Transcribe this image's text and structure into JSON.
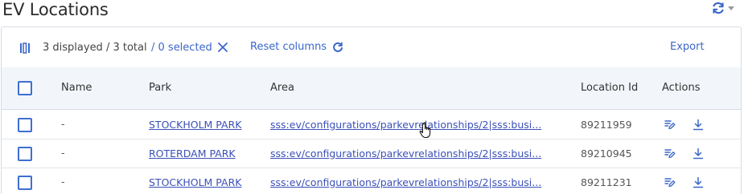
{
  "header": {
    "title": "EV Locations"
  },
  "toolbar": {
    "count_text": "3 displayed / 3 total",
    "selected_text": "/ 0 selected",
    "reset_label": "Reset columns",
    "export_label": "Export"
  },
  "table": {
    "columns": [
      "Name",
      "Park",
      "Area",
      "Location Id",
      "Actions"
    ],
    "rows": [
      {
        "name": "-",
        "park": "STOCKHOLM PARK",
        "area": "sss:ev/configurations/parkevrelationships/2|sss:busi...",
        "location_id": "89211959"
      },
      {
        "name": "-",
        "park": "ROTERDAM PARK",
        "area": "sss:ev/configurations/parkevrelationships/2|sss:busi...",
        "location_id": "89210945"
      },
      {
        "name": "-",
        "park": "STOCKHOLM PARK",
        "area": "sss:ev/configurations/parkevrelationships/2|sss:busi...",
        "location_id": "89211231"
      }
    ]
  },
  "colors": {
    "accent": "#3b66c9",
    "link": "#3b50b8",
    "header_bg": "#f2f6fb",
    "border": "#d6dde5"
  },
  "icons": {
    "refresh": "refresh-icon",
    "columns": "columns-icon",
    "clear": "close-icon",
    "edit": "edit-icon",
    "download": "download-icon"
  }
}
